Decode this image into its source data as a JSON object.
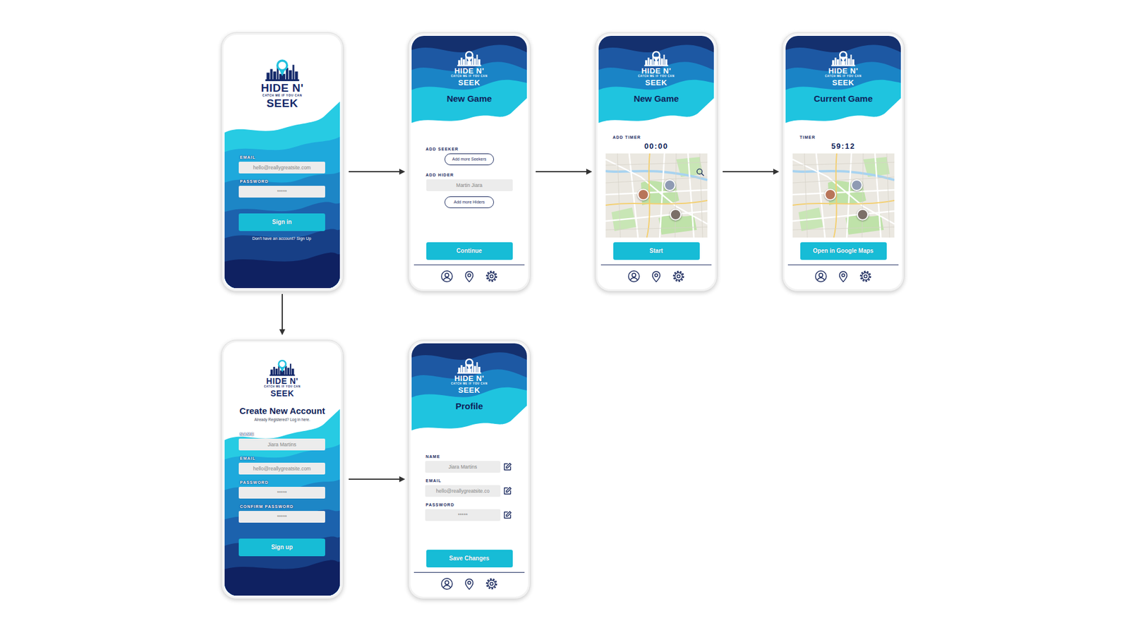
{
  "logo": {
    "line1": "HIDE N'",
    "tagline": "CATCH ME IF YOU CAN",
    "line2": "SEEK"
  },
  "screens": [
    {
      "kind": "auth",
      "items": [
        {
          "kind": "label",
          "text": "EMAIL"
        },
        {
          "kind": "field",
          "text": "hello@reallygreatsite.com"
        },
        {
          "kind": "label",
          "text": "PASSWORD"
        },
        {
          "kind": "field",
          "text": "*****"
        },
        {
          "kind": "button",
          "text": "Sign in"
        },
        {
          "kind": "note",
          "text": "Don't have an account? Sign Up"
        }
      ]
    },
    {
      "kind": "app",
      "title": "New Game",
      "items": [
        {
          "kind": "label",
          "text": "ADD SEEKER"
        },
        {
          "kind": "outline-button",
          "text": "Add more Seekers"
        },
        {
          "kind": "label",
          "text": "ADD HIDER"
        },
        {
          "kind": "field",
          "text": "Martin Jiara"
        },
        {
          "kind": "outline-button",
          "text": "Add more Hiders"
        },
        {
          "kind": "button",
          "text": "Continue"
        }
      ]
    },
    {
      "kind": "app",
      "title": "New Game",
      "items": [
        {
          "kind": "label",
          "text": "ADD TIMER"
        },
        {
          "kind": "timer",
          "text": "00:00"
        },
        {
          "kind": "map",
          "search": true
        },
        {
          "kind": "button",
          "text": "Start"
        }
      ]
    },
    {
      "kind": "app",
      "title": "Current Game",
      "items": [
        {
          "kind": "label",
          "text": "TIMER"
        },
        {
          "kind": "timer",
          "text": "59:12"
        },
        {
          "kind": "map",
          "search": false
        },
        {
          "kind": "button",
          "text": "Open in Google Maps"
        }
      ]
    },
    {
      "kind": "auth",
      "title": "Create New Account",
      "subtitle": "Already Registered? Log in here.",
      "items": [
        {
          "kind": "label",
          "text": "NAME"
        },
        {
          "kind": "field",
          "text": "Jiara Martins"
        },
        {
          "kind": "label",
          "text": "EMAIL"
        },
        {
          "kind": "field",
          "text": "hello@reallygreatsite.com"
        },
        {
          "kind": "label",
          "text": "PASSWORD"
        },
        {
          "kind": "field",
          "text": "*****"
        },
        {
          "kind": "label",
          "text": "CONFIRM PASSWORD"
        },
        {
          "kind": "field",
          "text": "*****"
        },
        {
          "kind": "button",
          "text": "Sign up"
        }
      ]
    },
    {
      "kind": "app",
      "title": "Profile",
      "items": [
        {
          "kind": "label",
          "text": "NAME"
        },
        {
          "kind": "edit-field",
          "text": "Jiara Martins"
        },
        {
          "kind": "label",
          "text": "EMAIL"
        },
        {
          "kind": "edit-field",
          "text": "hello@reallygreatsite.co"
        },
        {
          "kind": "label",
          "text": "PASSWORD"
        },
        {
          "kind": "edit-field",
          "text": "*****"
        },
        {
          "kind": "button",
          "text": "Save Changes"
        }
      ]
    }
  ]
}
